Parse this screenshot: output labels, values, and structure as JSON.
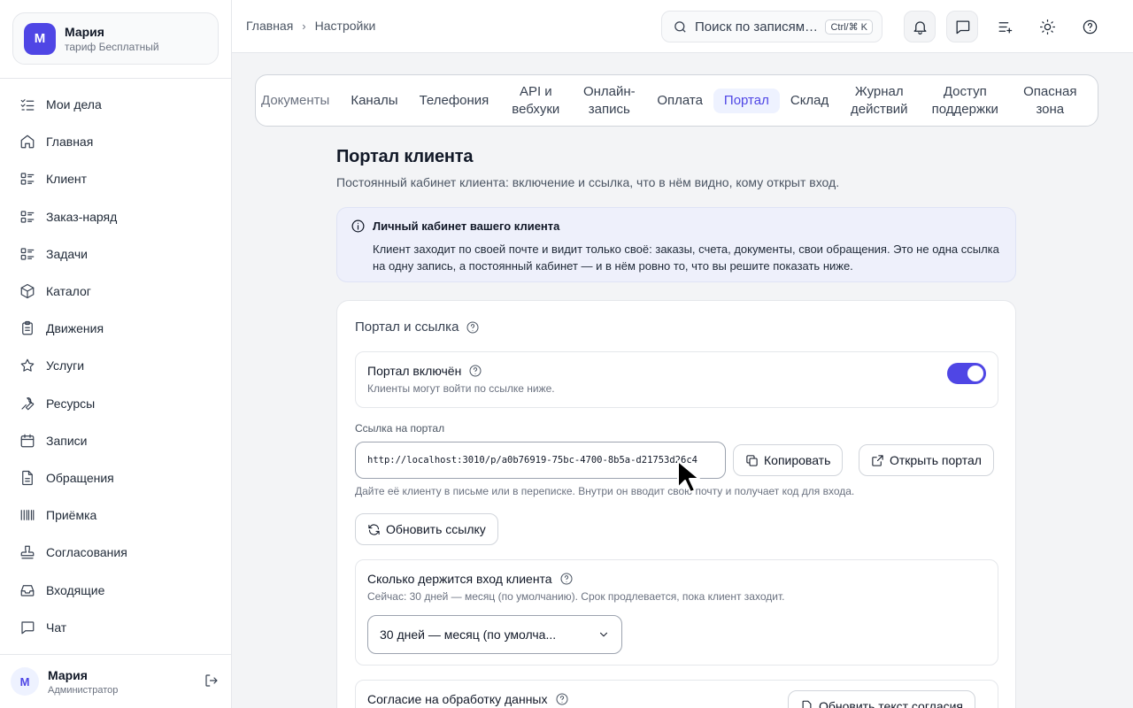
{
  "account": {
    "initial": "М",
    "name": "Мария",
    "plan": "тариф Бесплатный"
  },
  "sidebar": {
    "items": [
      {
        "label": "Мои дела",
        "icon": "checklist-icon"
      },
      {
        "label": "Главная",
        "icon": "home-icon"
      },
      {
        "label": "Клиент",
        "icon": "list-icon"
      },
      {
        "label": "Заказ-наряд",
        "icon": "list-icon"
      },
      {
        "label": "Задачи",
        "icon": "list-icon"
      },
      {
        "label": "Каталог",
        "icon": "box-icon"
      },
      {
        "label": "Движения",
        "icon": "clipboard-icon"
      },
      {
        "label": "Услуги",
        "icon": "star-icon"
      },
      {
        "label": "Ресурсы",
        "icon": "wrench-icon"
      },
      {
        "label": "Записи",
        "icon": "calendar-icon"
      },
      {
        "label": "Обращения",
        "icon": "document-icon"
      },
      {
        "label": "Приёмка",
        "icon": "barcode-icon"
      },
      {
        "label": "Согласования",
        "icon": "stamp-icon"
      },
      {
        "label": "Входящие",
        "icon": "inbox-icon"
      },
      {
        "label": "Чат",
        "icon": "chat-icon"
      }
    ]
  },
  "user": {
    "initial": "М",
    "name": "Мария",
    "role": "Администратор"
  },
  "header": {
    "breadcrumb": [
      "Главная",
      "Настройки"
    ],
    "search_placeholder": "Поиск по записям…",
    "search_shortcut": "Ctrl/⌘ K"
  },
  "tabs": [
    {
      "label": "Документы",
      "active": false
    },
    {
      "label": "Каналы",
      "active": false
    },
    {
      "label": "Телефония",
      "active": false
    },
    {
      "label": "API и вебхуки",
      "active": false
    },
    {
      "label": "Онлайн-запись",
      "active": false
    },
    {
      "label": "Оплата",
      "active": false
    },
    {
      "label": "Портал",
      "active": true
    },
    {
      "label": "Склад",
      "active": false
    },
    {
      "label": "Журнал действий",
      "active": false
    },
    {
      "label": "Доступ поддержки",
      "active": false
    },
    {
      "label": "Опасная зона",
      "active": false
    }
  ],
  "page": {
    "title": "Портал клиента",
    "subtitle": "Постоянный кабинет клиента: включение и ссылка, что в нём видно, кому открыт вход."
  },
  "info": {
    "title": "Личный кабинет вашего клиента",
    "body": "Клиент заходит по своей почте и видит только своё: заказы, счета, документы, свои обращения. Это не одна ссылка на одну запись, а постоянный кабинет — и в нём ровно то, что вы решите показать ниже."
  },
  "portal_card": {
    "heading": "Портал и ссылка",
    "enabled_title": "Портал включён",
    "enabled_desc": "Клиенты могут войти по ссылке ниже.",
    "enabled": true,
    "link_label": "Ссылка на портал",
    "link_value": "http://localhost:3010/p/a0b76919-75bc-4700-8b5a-d21753d26c4",
    "copy_label": "Копировать",
    "open_label": "Открыть портал",
    "hint": "Дайте её клиенту в письме или в переписке. Внутри он вводит свою почту и получает код для входа.",
    "refresh_label": "Обновить ссылку",
    "session_title": "Сколько держится вход клиента",
    "session_desc": "Сейчас: 30 дней — месяц (по умолчанию). Срок продлевается, пока клиент заходит.",
    "session_value": "30 дней — месяц (по умолча...",
    "consent_title": "Согласие на обработку данных",
    "consent_button": "Обновить текст согласия"
  }
}
